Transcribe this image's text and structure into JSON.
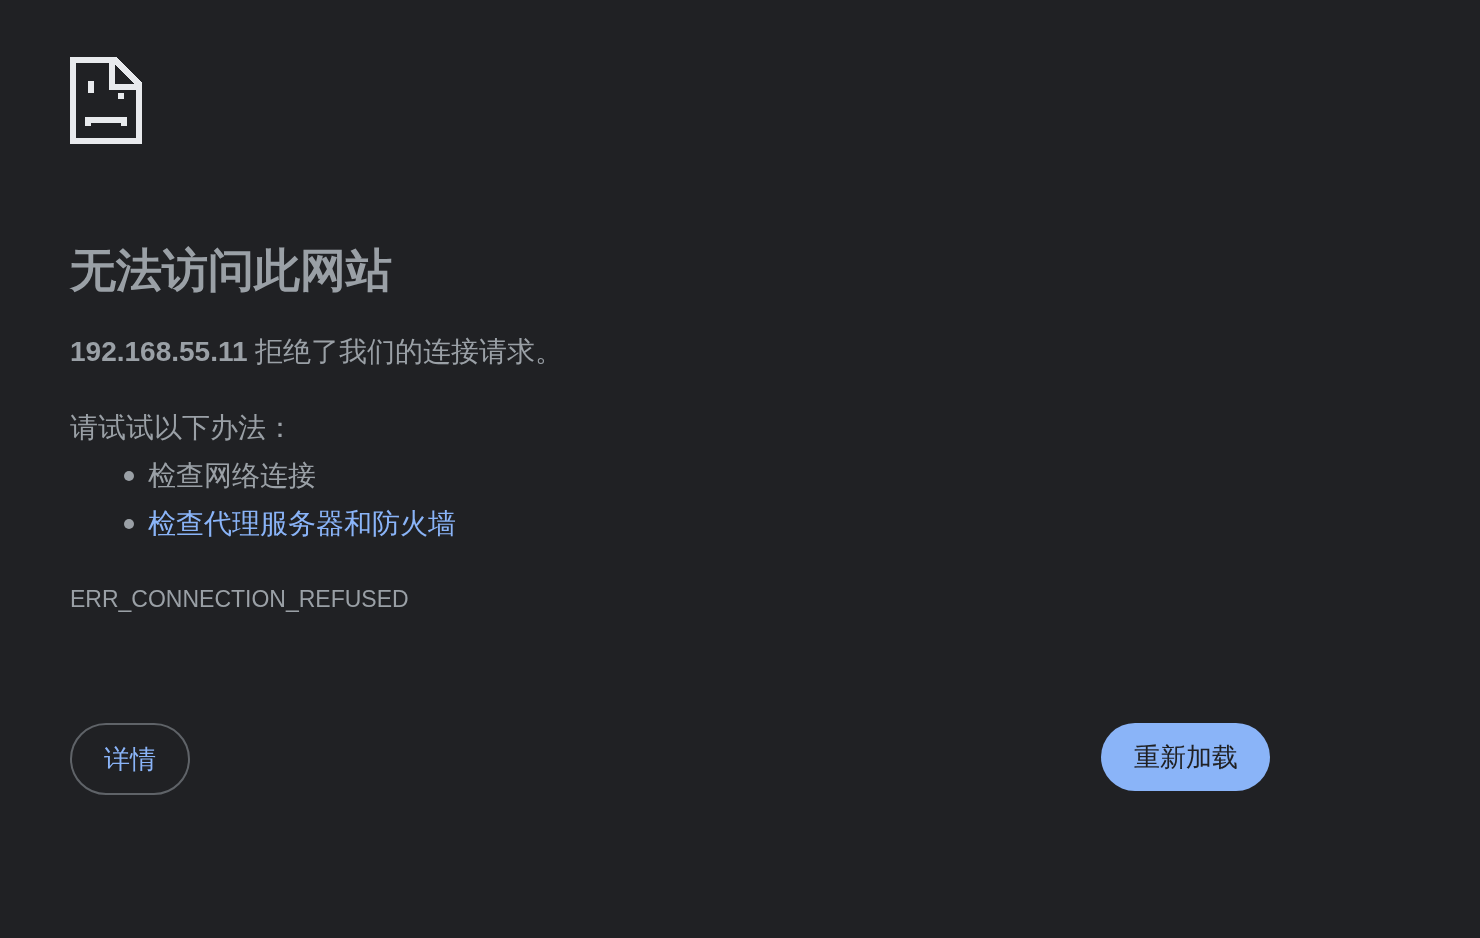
{
  "title": "无法访问此网站",
  "message": "**192.168.55.11** 拒绝了我们的连接请求。",
  "suggestions_heading": "请试试以下办法：",
  "suggestions": [
    {
      "text": "检查网络连接",
      "kind": "text"
    },
    {
      "text": "检查代理服务器和防火墙",
      "kind": "link"
    }
  ],
  "error_code": "ERR_CONNECTION_REFUSED",
  "buttons": {
    "details": "详情",
    "reload": "重新加载"
  }
}
